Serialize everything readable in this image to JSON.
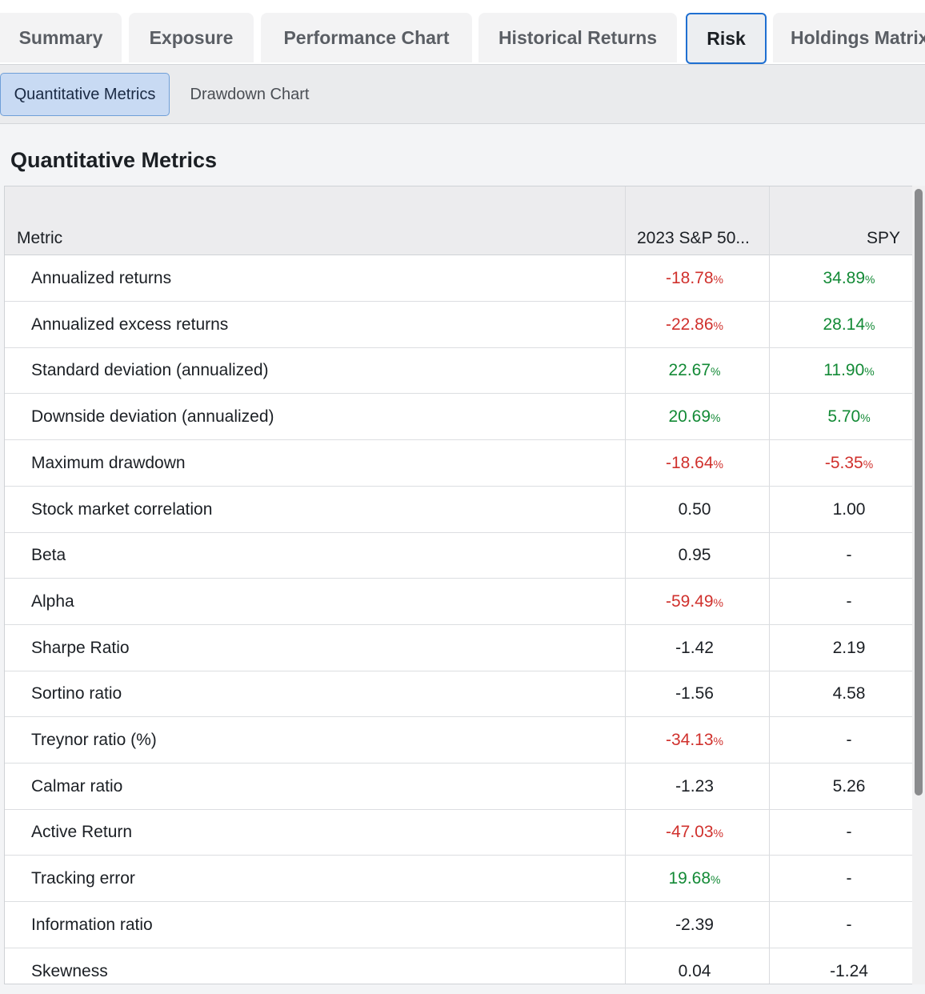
{
  "tabs": [
    {
      "label": "Summary"
    },
    {
      "label": "Exposure"
    },
    {
      "label": "Performance Chart"
    },
    {
      "label": "Historical Returns"
    },
    {
      "label": "Risk"
    },
    {
      "label": "Holdings Matrix"
    }
  ],
  "subtabs": [
    {
      "label": "Quantitative Metrics"
    },
    {
      "label": "Drawdown Chart"
    }
  ],
  "section_title": "Quantitative Metrics",
  "table": {
    "headers": {
      "metric": "Metric",
      "col1": "2023 S&P 50...",
      "col2": "SPY"
    },
    "pct_suffix": "%",
    "rows": [
      {
        "name": "Annualized returns",
        "v1": "-18.78",
        "v1_pct": true,
        "v1_tone": "neg",
        "v2": "34.89",
        "v2_pct": true,
        "v2_tone": "pos"
      },
      {
        "name": "Annualized excess returns",
        "v1": "-22.86",
        "v1_pct": true,
        "v1_tone": "neg",
        "v2": "28.14",
        "v2_pct": true,
        "v2_tone": "pos"
      },
      {
        "name": "Standard deviation (annualized)",
        "v1": "22.67",
        "v1_pct": true,
        "v1_tone": "pos",
        "v2": "11.90",
        "v2_pct": true,
        "v2_tone": "pos"
      },
      {
        "name": "Downside deviation (annualized)",
        "v1": "20.69",
        "v1_pct": true,
        "v1_tone": "pos",
        "v2": "5.70",
        "v2_pct": true,
        "v2_tone": "pos"
      },
      {
        "name": "Maximum drawdown",
        "v1": "-18.64",
        "v1_pct": true,
        "v1_tone": "neg",
        "v2": "-5.35",
        "v2_pct": true,
        "v2_tone": "neg"
      },
      {
        "name": "Stock market correlation",
        "v1": "0.50",
        "v1_pct": false,
        "v1_tone": "neu",
        "v2": "1.00",
        "v2_pct": false,
        "v2_tone": "neu"
      },
      {
        "name": "Beta",
        "v1": "0.95",
        "v1_pct": false,
        "v1_tone": "neu",
        "v2": "-",
        "v2_pct": false,
        "v2_tone": "neu"
      },
      {
        "name": "Alpha",
        "v1": "-59.49",
        "v1_pct": true,
        "v1_tone": "neg",
        "v2": "-",
        "v2_pct": false,
        "v2_tone": "neu"
      },
      {
        "name": "Sharpe Ratio",
        "v1": "-1.42",
        "v1_pct": false,
        "v1_tone": "neu",
        "v2": "2.19",
        "v2_pct": false,
        "v2_tone": "neu"
      },
      {
        "name": "Sortino ratio",
        "v1": "-1.56",
        "v1_pct": false,
        "v1_tone": "neu",
        "v2": "4.58",
        "v2_pct": false,
        "v2_tone": "neu"
      },
      {
        "name": "Treynor ratio (%)",
        "v1": "-34.13",
        "v1_pct": true,
        "v1_tone": "neg",
        "v2": "-",
        "v2_pct": false,
        "v2_tone": "neu"
      },
      {
        "name": "Calmar ratio",
        "v1": "-1.23",
        "v1_pct": false,
        "v1_tone": "neu",
        "v2": "5.26",
        "v2_pct": false,
        "v2_tone": "neu"
      },
      {
        "name": "Active Return",
        "v1": "-47.03",
        "v1_pct": true,
        "v1_tone": "neg",
        "v2": "-",
        "v2_pct": false,
        "v2_tone": "neu"
      },
      {
        "name": "Tracking error",
        "v1": "19.68",
        "v1_pct": true,
        "v1_tone": "pos",
        "v2": "-",
        "v2_pct": false,
        "v2_tone": "neu"
      },
      {
        "name": "Information ratio",
        "v1": "-2.39",
        "v1_pct": false,
        "v1_tone": "neu",
        "v2": "-",
        "v2_pct": false,
        "v2_tone": "neu"
      },
      {
        "name": "Skewness",
        "v1": "0.04",
        "v1_pct": false,
        "v1_tone": "neu",
        "v2": "-1.24",
        "v2_pct": false,
        "v2_tone": "neu"
      }
    ]
  },
  "colors": {
    "negative": "#d0312d",
    "positive": "#138a36",
    "accent": "#1f6fd1"
  }
}
